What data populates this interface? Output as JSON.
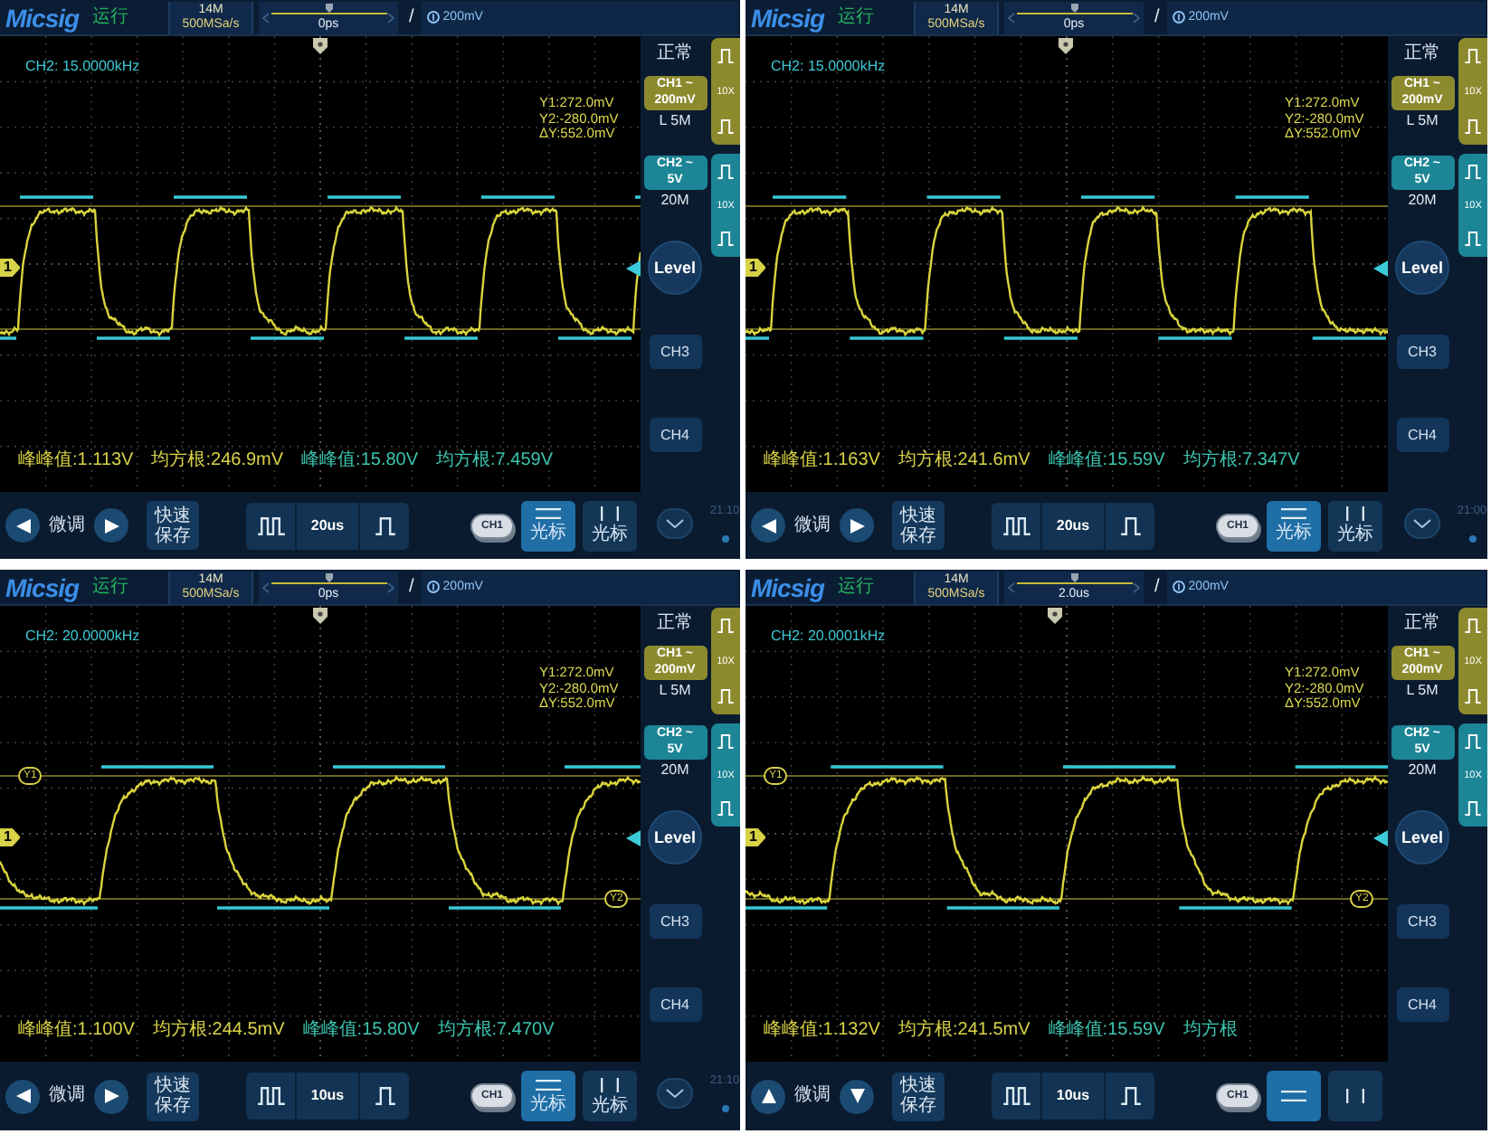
{
  "panels": [
    {
      "top_bar": {
        "brand": "Micsig",
        "run_status": "运行",
        "memory_depth": "14M",
        "sample_rate": "500MSa/s",
        "trigger_position": "0ps",
        "trigger_slope": "/",
        "trigger_level": "200mV"
      },
      "screen": {
        "frequency": "CH2: 15.0000kHz",
        "ch1_marker": "1",
        "cursor_readouts": [
          "Y1:272.0mV",
          "Y2:-280.0mV",
          "ΔY:552.0mV"
        ],
        "measurements": [
          {
            "text": "峰峰值:1.113V",
            "color": "#d8d247"
          },
          {
            "text": "均方根:246.9mV",
            "color": "#d8d247"
          },
          {
            "text": "峰峰值:15.80V",
            "color": "#3cc4b0"
          },
          {
            "text": "均方根:7.459V",
            "color": "#3cc4b0"
          }
        ]
      },
      "side_panel": {
        "trigger_mode": "正常",
        "channels": [
          {
            "name": "CH1",
            "coupling": "~",
            "scale": "200mV",
            "bandwidth": "L 5M",
            "probe": "10X",
            "color": "#8d8a2e"
          },
          {
            "name": "CH2",
            "coupling": "~",
            "scale": "5V",
            "bandwidth": "20M",
            "probe": "10X",
            "color": "#1c8596"
          }
        ],
        "level_button": "Level",
        "channel_buttons": [
          "CH3",
          "CH4"
        ],
        "expand_button": true,
        "clock": "21:10"
      },
      "bottom_bar": {
        "fine_tune": {
          "kind": "horizontal",
          "label": "微调"
        },
        "quick_save": "快速保存",
        "timebase": "20us",
        "channel_toggle": "CH1",
        "cursor_buttons": [
          {
            "kind": "horizontal",
            "label": "光标",
            "selected": true
          },
          {
            "kind": "vertical",
            "label": "光标",
            "selected": false
          }
        ]
      }
    },
    {
      "top_bar": {
        "brand": "Micsig",
        "run_status": "运行",
        "memory_depth": "14M",
        "sample_rate": "500MSa/s",
        "trigger_position": "0ps",
        "trigger_slope": "/",
        "trigger_level": "200mV"
      },
      "screen": {
        "frequency": "CH2: 15.0000kHz",
        "ch1_marker": "1",
        "cursor_readouts": [
          "Y1:272.0mV",
          "Y2:-280.0mV",
          "ΔY:552.0mV"
        ],
        "measurements": [
          {
            "text": "峰峰值:1.163V",
            "color": "#d8d247"
          },
          {
            "text": "均方根:241.6mV",
            "color": "#d8d247"
          },
          {
            "text": "峰峰值:15.59V",
            "color": "#3cc4b0"
          },
          {
            "text": "均方根:7.347V",
            "color": "#3cc4b0"
          }
        ]
      },
      "side_panel": {
        "trigger_mode": "正常",
        "channels": [
          {
            "name": "CH1",
            "coupling": "~",
            "scale": "200mV",
            "bandwidth": "L 5M",
            "probe": "10X",
            "color": "#8d8a2e"
          },
          {
            "name": "CH2",
            "coupling": "~",
            "scale": "5V",
            "bandwidth": "20M",
            "probe": "10X",
            "color": "#1c8596"
          }
        ],
        "level_button": "Level",
        "channel_buttons": [
          "CH3",
          "CH4"
        ],
        "expand_button": true,
        "clock": "21:00"
      },
      "bottom_bar": {
        "fine_tune": {
          "kind": "horizontal",
          "label": "微调"
        },
        "quick_save": "快速保存",
        "timebase": "20us",
        "channel_toggle": "CH1",
        "cursor_buttons": [
          {
            "kind": "horizontal",
            "label": "光标",
            "selected": true
          },
          {
            "kind": "vertical",
            "label": "光标",
            "selected": false
          }
        ]
      }
    },
    {
      "top_bar": {
        "brand": "Micsig",
        "run_status": "运行",
        "memory_depth": "14M",
        "sample_rate": "500MSa/s",
        "trigger_position": "0ps",
        "trigger_slope": "/",
        "trigger_level": "200mV"
      },
      "screen": {
        "frequency": "CH2: 20.0000kHz",
        "ch1_marker": "1",
        "cursor_tags": [
          "Y1",
          "Y2"
        ],
        "cursor_readouts": [
          "Y1:272.0mV",
          "Y2:-280.0mV",
          "ΔY:552.0mV"
        ],
        "measurements": [
          {
            "text": "峰峰值:1.100V",
            "color": "#d8d247"
          },
          {
            "text": "均方根:244.5mV",
            "color": "#d8d247"
          },
          {
            "text": "峰峰值:15.80V",
            "color": "#3cc4b0"
          },
          {
            "text": "均方根:7.470V",
            "color": "#3cc4b0"
          }
        ]
      },
      "side_panel": {
        "trigger_mode": "正常",
        "channels": [
          {
            "name": "CH1",
            "coupling": "~",
            "scale": "200mV",
            "bandwidth": "L 5M",
            "probe": "10X",
            "color": "#8d8a2e"
          },
          {
            "name": "CH2",
            "coupling": "~",
            "scale": "5V",
            "bandwidth": "20M",
            "probe": "10X",
            "color": "#1c8596"
          }
        ],
        "level_button": "Level",
        "channel_buttons": [
          "CH3",
          "CH4"
        ],
        "expand_button": true,
        "clock": "21:10"
      },
      "bottom_bar": {
        "fine_tune": {
          "kind": "horizontal",
          "label": "微调"
        },
        "quick_save": "快速保存",
        "timebase": "10us",
        "channel_toggle": "CH1",
        "cursor_buttons": [
          {
            "kind": "horizontal",
            "label": "光标",
            "selected": true
          },
          {
            "kind": "vertical",
            "label": "光标",
            "selected": false
          }
        ]
      }
    },
    {
      "top_bar": {
        "brand": "Micsig",
        "run_status": "运行",
        "memory_depth": "14M",
        "sample_rate": "500MSa/s",
        "trigger_position": "2.0us",
        "trigger_slope": "/",
        "trigger_level": "200mV"
      },
      "screen": {
        "frequency": "CH2: 20.0001kHz",
        "ch1_marker": "1",
        "cursor_tags": [
          "Y1",
          "Y2"
        ],
        "cursor_readouts": [
          "Y1:272.0mV",
          "Y2:-280.0mV",
          "ΔY:552.0mV"
        ],
        "measurements": [
          {
            "text": "峰峰值:1.132V",
            "color": "#d8d247"
          },
          {
            "text": "均方根:241.5mV",
            "color": "#d8d247"
          },
          {
            "text": "峰峰值:15.59V",
            "color": "#3cc4b0"
          },
          {
            "text": "均方根",
            "color": "#3cc4b0"
          }
        ]
      },
      "side_panel": {
        "trigger_mode": "正常",
        "channels": [
          {
            "name": "CH1",
            "coupling": "~",
            "scale": "200mV",
            "bandwidth": "L 5M",
            "probe": "10X",
            "color": "#8d8a2e"
          },
          {
            "name": "CH2",
            "coupling": "~",
            "scale": "5V",
            "bandwidth": "20M",
            "probe": "10X",
            "color": "#1c8596"
          }
        ],
        "level_button": "Level",
        "channel_buttons": [
          "CH3",
          "CH4"
        ]
      },
      "bottom_bar": {
        "fine_tune": {
          "kind": "vertical",
          "label": "微调"
        },
        "quick_save": "快速保存",
        "timebase": "10us",
        "channel_toggle": "CH1",
        "cursor_buttons": [
          {
            "kind": "horizontal",
            "selected": true
          },
          {
            "kind": "vertical",
            "selected": false
          }
        ]
      }
    }
  ]
}
